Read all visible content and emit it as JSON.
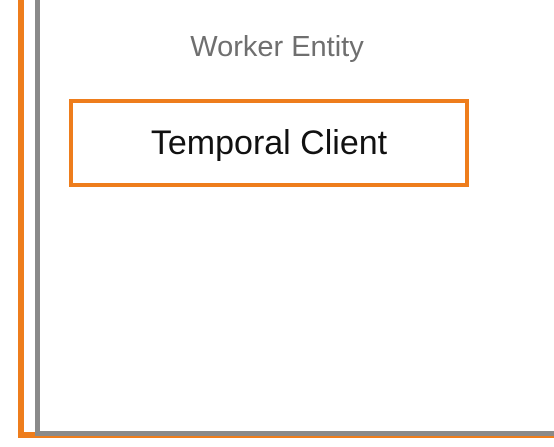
{
  "diagram": {
    "worker": {
      "title": "Worker Entity"
    },
    "client": {
      "label": "Temporal Client"
    }
  },
  "colors": {
    "accent": "#ee7d1c",
    "worker_border": "#8a8a8a",
    "worker_title_text": "#6f6f6f",
    "client_text": "#111111"
  }
}
